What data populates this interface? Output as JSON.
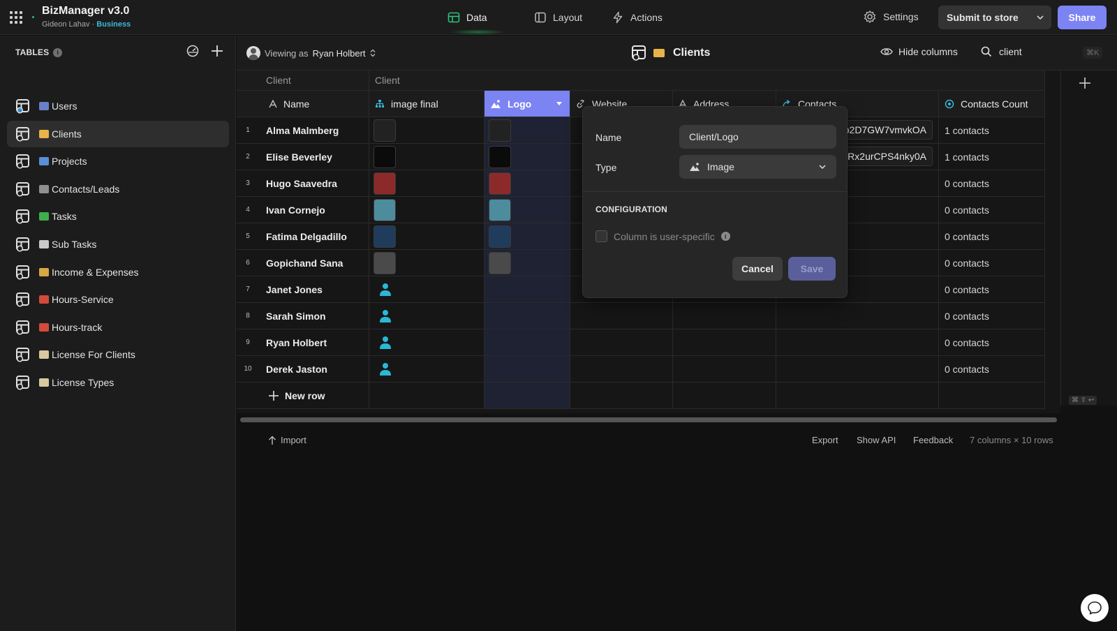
{
  "app": {
    "title": "BizManager v3.0",
    "owner": "Gideon Lahav",
    "separator": "·",
    "plan": "Business"
  },
  "nav": {
    "tabs": [
      {
        "label": "Data"
      },
      {
        "label": "Layout"
      },
      {
        "label": "Actions"
      }
    ]
  },
  "header_actions": {
    "settings": "Settings",
    "submit": "Submit to store",
    "share": "Share"
  },
  "sidebar": {
    "label": "TABLES",
    "info": "i",
    "items": [
      {
        "label": "Users",
        "emoji_color": "#6a7fc9"
      },
      {
        "label": "Clients",
        "emoji_color": "#e8b34a"
      },
      {
        "label": "Projects",
        "emoji_color": "#5a8fd6"
      },
      {
        "label": "Contacts/Leads",
        "emoji_color": "#8f8f8f"
      },
      {
        "label": "Tasks",
        "emoji_color": "#3fae4a"
      },
      {
        "label": "Sub Tasks",
        "emoji_color": "#c9c9c9"
      },
      {
        "label": "Income & Expenses",
        "emoji_color": "#d9a843"
      },
      {
        "label": "Hours-Service",
        "emoji_color": "#d24a3c"
      },
      {
        "label": "Hours-track",
        "emoji_color": "#d24a3c"
      },
      {
        "label": "License For Clients",
        "emoji_color": "#d8c9a0"
      },
      {
        "label": "License Types",
        "emoji_color": "#d8c9a0"
      }
    ]
  },
  "main_header": {
    "viewing_prefix": "Viewing as",
    "viewing_user": "Ryan Holbert",
    "table_title": "Clients",
    "hide_columns": "Hide columns",
    "search_value": "client",
    "shortcut": "⌘K"
  },
  "grid": {
    "group_labels": [
      "Client",
      "Client"
    ],
    "columns": [
      "Name",
      "image final",
      "Logo",
      "Website",
      "Address",
      "Contacts",
      "Contacts Count"
    ],
    "rows": [
      {
        "num": "1",
        "name": "Alma Malmberg",
        "contact": "Ro2D7GW7vmvkOA",
        "count": "1 contacts",
        "thumb": "#222222"
      },
      {
        "num": "2",
        "name": "Elise Beverley",
        "contact": "Rx2urCPS4nky0A",
        "count": "1 contacts",
        "thumb": "#0b0b0b"
      },
      {
        "num": "3",
        "name": "Hugo Saavedra",
        "contact": "",
        "count": "0 contacts",
        "thumb": "#8c2a2a"
      },
      {
        "num": "4",
        "name": "Ivan Cornejo",
        "contact": "",
        "count": "0 contacts",
        "thumb": "#4d8c9c"
      },
      {
        "num": "5",
        "name": "Fatima Delgadillo",
        "contact": "",
        "count": "0 contacts",
        "thumb": "#1f3c5c"
      },
      {
        "num": "6",
        "name": "Gopichand Sana",
        "contact": "",
        "count": "0 contacts",
        "thumb": "#4a4a4a"
      },
      {
        "num": "7",
        "name": "Janet Jones",
        "contact": "",
        "count": "0 contacts",
        "thumb": ""
      },
      {
        "num": "8",
        "name": "Sarah Simon",
        "contact": "",
        "count": "0 contacts",
        "thumb": ""
      },
      {
        "num": "9",
        "name": "Ryan Holbert",
        "contact": "",
        "count": "0 contacts",
        "thumb": ""
      },
      {
        "num": "10",
        "name": "Derek Jaston",
        "contact": "",
        "count": "0 contacts",
        "thumb": ""
      }
    ],
    "new_row": "New row"
  },
  "footer": {
    "import": "Import",
    "export": "Export",
    "show_api": "Show API",
    "feedback": "Feedback",
    "summary": "7 columns × 10 rows",
    "mini_shortcut": "⌘ ⇧ ↩"
  },
  "popover": {
    "name_label": "Name",
    "name_value": "Client/Logo",
    "type_label": "Type",
    "type_value": "Image",
    "section": "CONFIGURATION",
    "user_specific": "Column is user-specific",
    "info": "i",
    "cancel": "Cancel",
    "save": "Save"
  }
}
